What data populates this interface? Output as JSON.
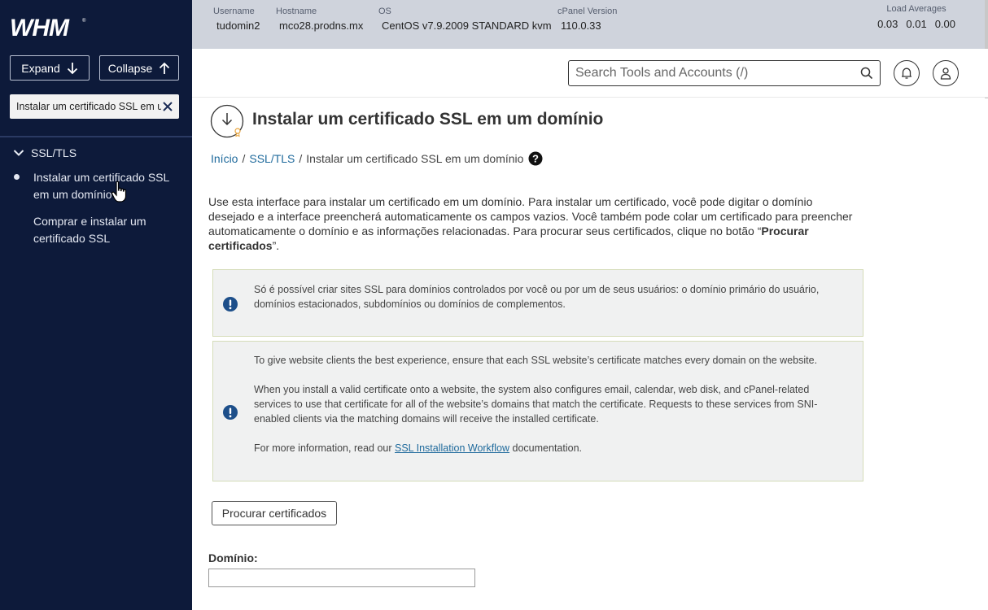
{
  "sidebar": {
    "logo_text": "WHM",
    "expand_label": "Expand",
    "collapse_label": "Collapse",
    "search_value": "Instalar um certificado SSL em um",
    "category": "SSL/TLS",
    "items": [
      {
        "label": "Instalar um certificado SSL em um domínio",
        "active": true
      },
      {
        "label": "Comprar e instalar um certificado SSL",
        "active": false
      }
    ]
  },
  "server_info": {
    "username_label": "Username",
    "username": "tudomin2",
    "hostname_label": "Hostname",
    "hostname": "mco28.prodns.mx",
    "os_label": "OS",
    "os": "CentOS v7.9.2009 STANDARD kvm",
    "cpanel_label": "cPanel Version",
    "cpanel_version": "110.0.33",
    "load_label": "Load Averages",
    "load": [
      "0.03",
      "0.01",
      "0.00"
    ]
  },
  "header": {
    "search_placeholder": "Search Tools and Accounts (/)"
  },
  "page": {
    "title": "Instalar um certificado SSL em um domínio",
    "breadcrumb": [
      "Início",
      "SSL/TLS",
      "Instalar um certificado SSL em um domínio"
    ],
    "intro_text": "Use esta interface para instalar um certificado em um domínio. Para instalar um certificado, você pode digitar o domínio desejado e a interface preencherá automaticamente os campos vazios. Você também pode colar um certificado para preencher automaticamente o domínio e as informações relacionadas. Para procurar seus certificados, clique no botão “",
    "intro_bold": "Procurar certificados",
    "intro_end": "”.",
    "notice1": "Só é possível criar sites SSL para domínios controlados por você ou por um de seus usuários: o domínio primário do usuário, domínios estacionados, subdomínios ou domínios de complementos.",
    "notice2_p1": "To give website clients the best experience, ensure that each SSL website’s certificate matches every domain on the website.",
    "notice2_p2": "When you install a valid certificate onto a website, the system also configures email, calendar, web disk, and cPanel-related services to use that certificate for all of the website’s domains that match the certificate. Requests to these services from SNI-enabled clients via the matching domains will receive the installed certificate.",
    "notice2_p3_pre": "For more information, read our ",
    "notice2_link": "SSL Installation Workflow",
    "notice2_p3_post": " documentation.",
    "browse_button": "Procurar certificados",
    "domain_label": "Domínio:"
  }
}
